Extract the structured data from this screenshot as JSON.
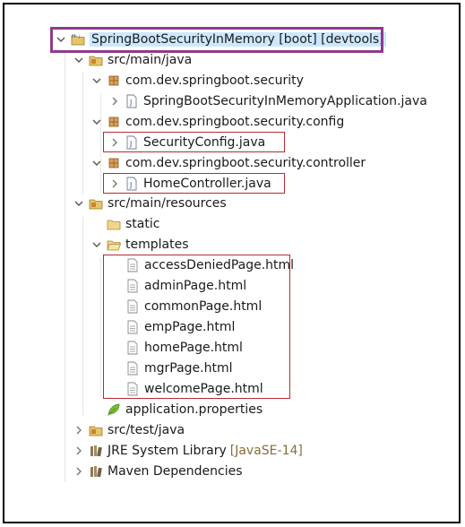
{
  "tree": {
    "project": {
      "label": "SpringBootSecurityInMemory",
      "decorations": "[boot] [devtools]"
    },
    "src_main_java": {
      "label": "src/main/java",
      "packages": [
        {
          "label": "com.dev.springboot.security",
          "files": [
            "SpringBootSecurityInMemoryApplication.java"
          ]
        },
        {
          "label": "com.dev.springboot.security.config",
          "files": [
            "SecurityConfig.java"
          ]
        },
        {
          "label": "com.dev.springboot.security.controller",
          "files": [
            "HomeController.java"
          ]
        }
      ]
    },
    "src_main_resources": {
      "label": "src/main/resources",
      "static_folder": "static",
      "templates_folder": "templates",
      "templates": [
        "accessDeniedPage.html",
        "adminPage.html",
        "commonPage.html",
        "empPage.html",
        "homePage.html",
        "mgrPage.html",
        "welcomePage.html"
      ],
      "properties": "application.properties"
    },
    "src_test_java": {
      "label": "src/test/java"
    },
    "jre": {
      "label": "JRE System Library",
      "decoration": "[JavaSE-14]"
    },
    "maven": {
      "label": "Maven Dependencies"
    }
  },
  "colors": {
    "highlight_border": "#8e3a8e",
    "box_border": "#b52b36",
    "selection_bg": "#cce8ff"
  },
  "icons": {
    "project": "project-icon",
    "source_folder": "source-folder-icon",
    "package": "package-icon",
    "java_file": "java-file-icon",
    "folder": "folder-icon",
    "html_file": "file-icon",
    "properties": "leaf-icon",
    "library": "library-icon"
  }
}
